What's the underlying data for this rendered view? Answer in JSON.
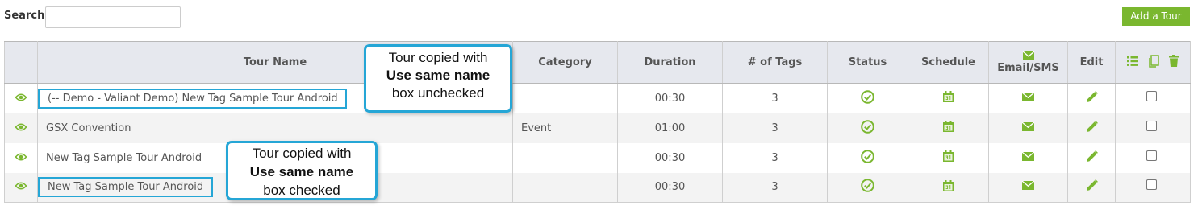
{
  "search": {
    "label": "Search",
    "value": ""
  },
  "add_button": {
    "label": "Add a Tour"
  },
  "columns": {
    "tour_name": "Tour Name",
    "category": "Category",
    "duration": "Duration",
    "tags": "# of Tags",
    "status": "Status",
    "schedule": "Schedule",
    "email_sms": "Email/SMS",
    "edit": "Edit"
  },
  "rows": [
    {
      "tour_name": "(-- Demo - Valiant Demo) New Tag Sample Tour Android",
      "category": "",
      "duration": "00:30",
      "tags": "3"
    },
    {
      "tour_name": "GSX Convention",
      "category": "Event",
      "duration": "01:00",
      "tags": "3"
    },
    {
      "tour_name": "New Tag Sample Tour Android",
      "category": "",
      "duration": "00:30",
      "tags": "3"
    },
    {
      "tour_name": "New Tag Sample Tour Android",
      "category": "",
      "duration": "00:30",
      "tags": "3"
    }
  ],
  "callouts": [
    {
      "line1": "Tour copied with",
      "line2": "Use same name",
      "line3": "box unchecked"
    },
    {
      "line1": "Tour copied with",
      "line2": "Use same name",
      "line3": "box checked"
    }
  ],
  "icons": {
    "view": "eye-icon",
    "status": "check-circle-icon",
    "schedule": "calendar-icon",
    "email": "envelope-icon",
    "edit": "pencil-icon",
    "list": "list-icon",
    "copy": "copy-icon",
    "delete": "trash-icon"
  },
  "colors": {
    "accent": "#7ab72f",
    "highlight": "#25a6d6",
    "header_bg": "#e6e8ee"
  }
}
